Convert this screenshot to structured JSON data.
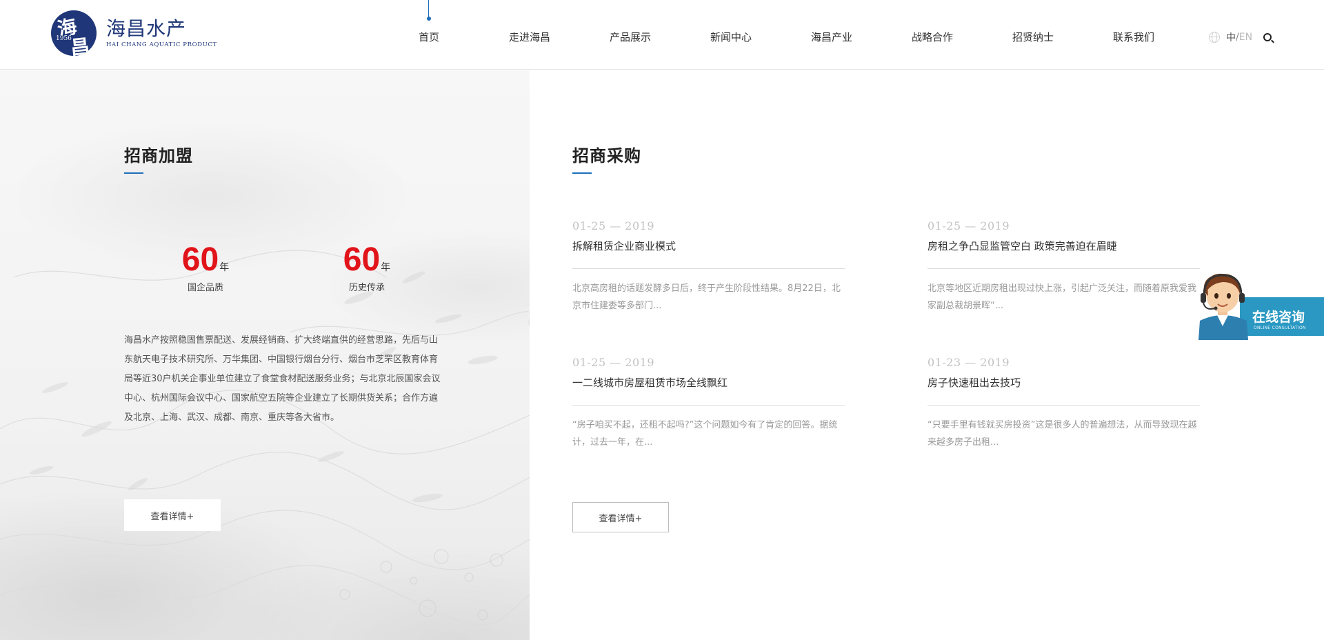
{
  "brand": {
    "seal_char_1": "海",
    "seal_char_2": "昌",
    "seal_year": "1956",
    "name_cn": "海昌水产",
    "name_en": "HAI CHANG AQUATIC PRODUCT"
  },
  "nav": {
    "items": [
      {
        "label": "首页",
        "active": true
      },
      {
        "label": "走进海昌",
        "active": false
      },
      {
        "label": "产品展示",
        "active": false
      },
      {
        "label": "新闻中心",
        "active": false
      },
      {
        "label": "海昌产业",
        "active": false
      },
      {
        "label": "战略合作",
        "active": false
      },
      {
        "label": "招贤纳士",
        "active": false
      },
      {
        "label": "联系我们",
        "active": false
      }
    ]
  },
  "lang": {
    "current": "中",
    "separator": "/",
    "other": "EN"
  },
  "icons": {
    "globe": "globe-icon",
    "search": "search-icon"
  },
  "colors": {
    "accent": "#1c6fba",
    "highlight_number": "#e1141a",
    "brand": "#1f3779",
    "consult": "#2a98c2"
  },
  "join": {
    "title": "招商加盟",
    "stats": [
      {
        "value": "60",
        "unit": "年",
        "label": "国企品质"
      },
      {
        "value": "60",
        "unit": "年",
        "label": "历史传承"
      }
    ],
    "intro": "海昌水产按照稳固售票配送、发展经销商、扩大终端直供的经营思路，先后与山东航天电子技术研究所、万华集团、中国银行烟台分行、烟台市芝罘区教育体育局等近30户机关企事业单位建立了食堂食材配送服务业务；与北京北辰国家会议中心、杭州国际会议中心、国家航空五院等企业建立了长期供货关系；合作方遍及北京、上海、武汉、成都、南京、重庆等各大省市。",
    "button_label": "查看详情+"
  },
  "purchase": {
    "title": "招商采购",
    "news": [
      {
        "date": "01-25 — 2019",
        "headline": "拆解租赁企业商业模式",
        "excerpt": "北京高房租的话题发酵多日后，终于产生阶段性结果。8月22日，北京市住建委等多部门..."
      },
      {
        "date": "01-25 — 2019",
        "headline": "房租之争凸显监管空白 政策完善迫在眉睫",
        "excerpt": "北京等地区近期房租出现过快上涨，引起广泛关注，而随着原我爱我家副总裁胡景晖“..."
      },
      {
        "date": "01-25 — 2019",
        "headline": "一二线城市房屋租赁市场全线飘红",
        "excerpt": "“房子咱买不起，还租不起吗?”这个问题如今有了肯定的回答。据统计，过去一年，在..."
      },
      {
        "date": "01-23 — 2019",
        "headline": "房子快速租出去技巧",
        "excerpt": "“只要手里有钱就买房投资”这是很多人的普遍想法，从而导致现在越来越多房子出租..."
      }
    ],
    "button_label": "查看详情+"
  },
  "consult": {
    "label_cn": "在线咨询",
    "label_en": "ONLINE CONSULTATION"
  }
}
